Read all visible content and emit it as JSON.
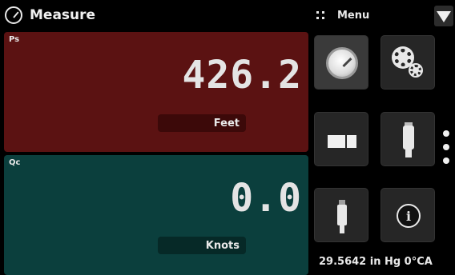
{
  "header": {
    "title": "Measure",
    "menu_label": "Menu",
    "title_icon": "gauge-icon",
    "menu_icon": "grid-icon",
    "dropdown_icon": "triangle-down-icon"
  },
  "panels": [
    {
      "label": "Ps",
      "value": "426.2",
      "unit": "Feet",
      "color": "#5b1212"
    },
    {
      "label": "Qc",
      "value": "0.0",
      "unit": "Knots",
      "color": "#0b3f3d"
    }
  ],
  "menu_tiles": [
    {
      "icon": "gauge-icon"
    },
    {
      "icon": "gears-icon"
    },
    {
      "icon": "split-window-icon"
    },
    {
      "icon": "usb-device-icon"
    },
    {
      "icon": "usb-plug-icon"
    },
    {
      "icon": "info-icon",
      "glyph": "i"
    }
  ],
  "pager": {
    "pages": 3,
    "icon": "page-dots-icon"
  },
  "status_bar": {
    "barometric": "29.5642 in Hg 0°CA"
  }
}
